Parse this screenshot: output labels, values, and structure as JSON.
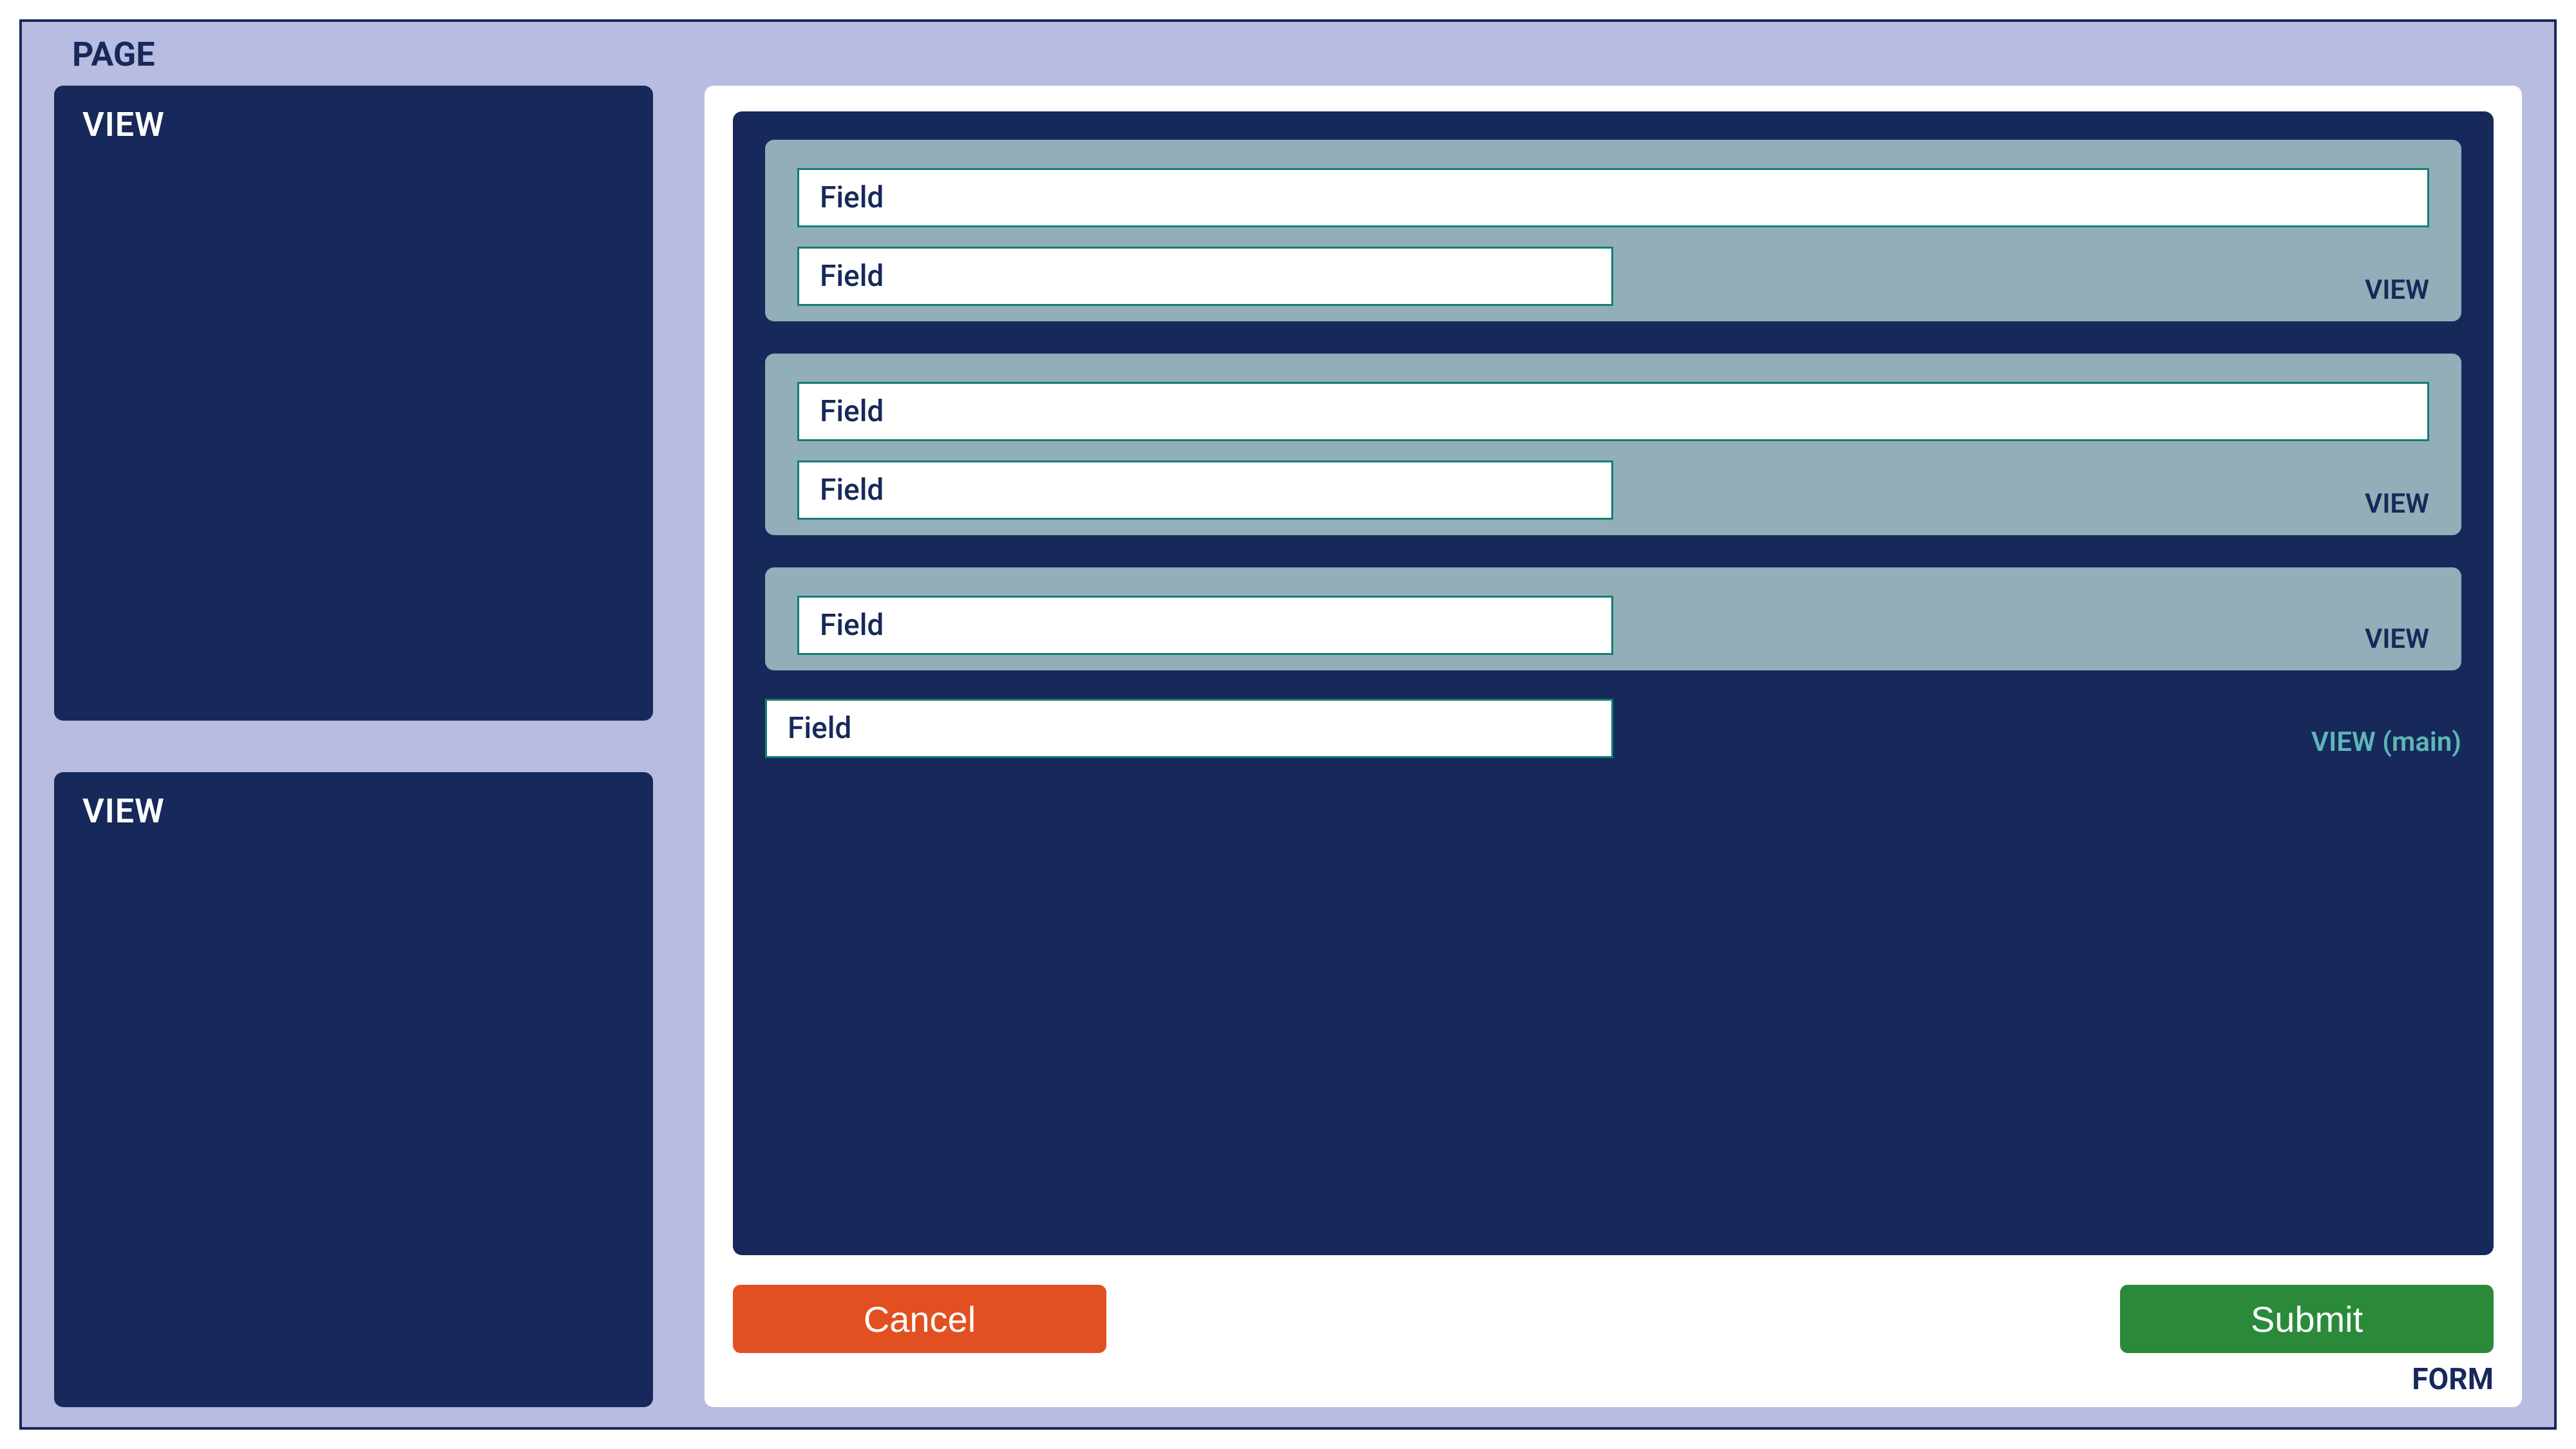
{
  "page": {
    "label": "PAGE"
  },
  "sidebar": {
    "views": [
      {
        "label": "VIEW"
      },
      {
        "label": "VIEW"
      }
    ]
  },
  "form": {
    "label": "FORM",
    "main": {
      "tag": "VIEW (main)",
      "standalone_field_label": "Field",
      "views": [
        {
          "tag": "VIEW",
          "fields": [
            {
              "label": "Field",
              "size": "full"
            },
            {
              "label": "Field",
              "size": "half"
            }
          ]
        },
        {
          "tag": "VIEW",
          "fields": [
            {
              "label": "Field",
              "size": "full"
            },
            {
              "label": "Field",
              "size": "half"
            }
          ]
        },
        {
          "tag": "VIEW",
          "fields": [
            {
              "label": "Field",
              "size": "half"
            }
          ]
        }
      ]
    },
    "buttons": {
      "cancel": "Cancel",
      "submit": "Submit"
    }
  }
}
